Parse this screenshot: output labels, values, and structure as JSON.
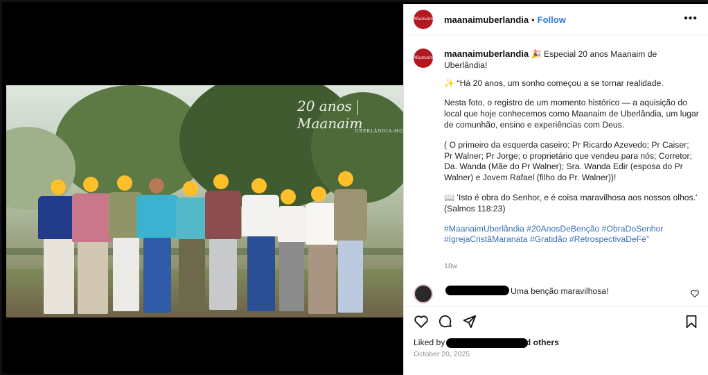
{
  "post": {
    "username": "maanaimuberlandia",
    "follow_label": "Follow",
    "separator": "•",
    "more_label": "•••",
    "avatar_text": "Maanaim",
    "caption": {
      "intro": "🎉 Especial 20 anos Maanaim de Uberlândia!",
      "quote": "✨ “Há 20 anos, um sonho começou a se tornar realidade.",
      "paragraph": "Nesta foto, o registro de um momento histórico — a aquisição do local que hoje conhecemos como Maanaim de Uberlândia, um lugar de comunhão, ensino e experiências com Deus.",
      "people": "( O primeiro da esquerda caseiro; Pr Ricardo Azevedo; Pr Caiser; Pr Walner; Pr Jorge; o proprietário que vendeu para nós; Corretor; Da. Wanda (Mãe do Pr Walner); Sra. Wanda Edir (esposa do Pr Walner) e Jovem Rafael (filho do Pr. Walner))!",
      "verse": "📖 'Isto é obra do Senhor, e é coisa maravilhosa aos nossos olhos.' (Salmos 118:23)",
      "hashtags": "#MaanaimUberlândia #20AnosDeBenção #ObraDoSenhor #IgrejaCristãMaranata #Gratidão #RetrospectivaDeFé”"
    },
    "time_ago": "18w",
    "comment": {
      "text": "Uma benção maravilhosa!"
    },
    "likes": {
      "prefix": "Liked by",
      "suffix": "d others"
    },
    "date": "October 20, 2025"
  },
  "watermark": {
    "years": "20 anos",
    "brand": "Maanaim",
    "sub": "UBERLÂNDIA-MG"
  },
  "icons": [
    "heart-icon",
    "comment-icon",
    "share-icon",
    "bookmark-icon",
    "more-icon"
  ]
}
